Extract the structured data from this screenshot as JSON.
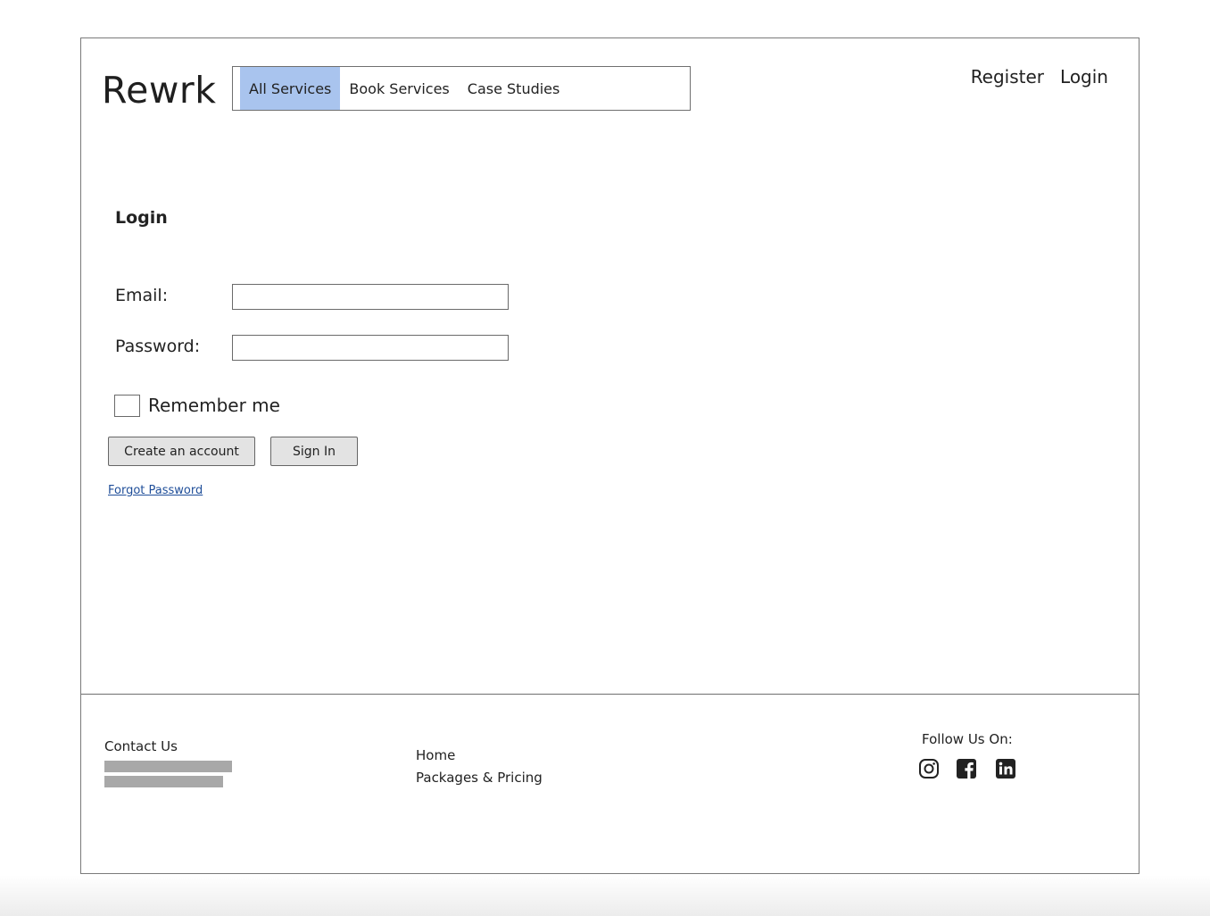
{
  "header": {
    "logo": "Rewrk",
    "nav": [
      {
        "label": "All Services",
        "active": true
      },
      {
        "label": "Book Services",
        "active": false
      },
      {
        "label": "Case Studies",
        "active": false
      }
    ],
    "links": {
      "register": "Register",
      "login": "Login"
    }
  },
  "login_form": {
    "title": "Login",
    "email_label": "Email:",
    "email_value": "",
    "password_label": "Password:",
    "password_value": "",
    "remember_label": "Remember me",
    "remember_checked": false,
    "create_account_label": "Create an account",
    "sign_in_label": "Sign In",
    "forgot_password_label": "Forgot Password"
  },
  "footer": {
    "contact_title": "Contact Us",
    "links": [
      "Home",
      "Packages & Pricing"
    ],
    "follow_title": "Follow Us On:",
    "social_icons": [
      "instagram-icon",
      "facebook-icon",
      "linkedin-icon"
    ]
  },
  "colors": {
    "nav_active": "#a9c4ee",
    "link": "#1f4e99",
    "button_bg": "#e3e3e3",
    "placeholder_bar": "#a8a8a8"
  }
}
